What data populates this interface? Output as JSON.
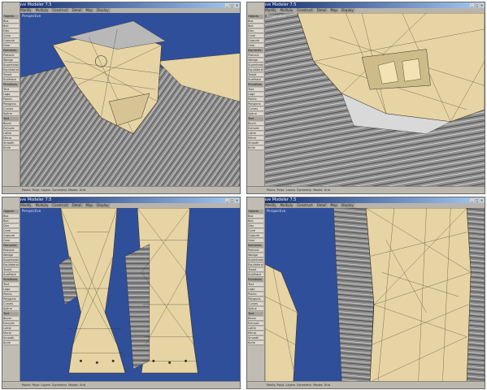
{
  "app_title": "LightWave Modeler 7.5",
  "tabs": [
    "Create",
    "Modify",
    "Multiply",
    "Construct",
    "Detail",
    "Map",
    "Display",
    "Edit"
  ],
  "toolbar_groups": [
    "Objects",
    "Elements",
    "Primitives",
    "Text"
  ],
  "toolbar_buttons": [
    "Box",
    "Ball",
    "Disc",
    "Cone",
    "Capsule",
    "Gear",
    "Platonic",
    "Wedge",
    "Supertoroid",
    "Equilateral",
    "Toroid",
    "SubPatch",
    "Text",
    "Logo",
    "Points",
    "Polygons",
    "Curves",
    "Spline",
    "Bevel",
    "Extrude",
    "Lathe",
    "Mirror",
    "Smooth",
    "Knife"
  ],
  "viewport_label": "Perspective",
  "status_items": [
    "Points",
    "Polys",
    "Layers",
    "Symmetry",
    "Modes",
    "Grid"
  ],
  "windows": [
    {
      "name": "top-left",
      "view": "Head"
    },
    {
      "name": "top-right",
      "view": "Head Closeup"
    },
    {
      "name": "bottom-left",
      "view": "Legs"
    },
    {
      "name": "bottom-right",
      "view": "Torso Closeup"
    }
  ],
  "colors": {
    "viewport_bg": "#2f4f9a",
    "mesh": "#e6d4a4",
    "fur": "#9a9a9a",
    "wire": "#3a3020"
  }
}
